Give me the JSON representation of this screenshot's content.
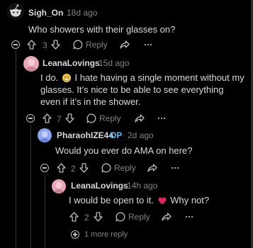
{
  "comments": [
    {
      "username": "Sigh_On",
      "time": "18d ago",
      "body": "Who showers with their glasses on?",
      "votes": "3",
      "reply_label": "Reply"
    },
    {
      "username": "LeanaLovings",
      "time": "15d ago",
      "body_part1": "I do.",
      "body_part2": " I hate having a single moment without my glasses. It’s nice to be able to see everything even if it’s in the shower.",
      "emoji": "grimacing-face",
      "votes": "7",
      "reply_label": "Reply"
    },
    {
      "username": "PharaohIZE44",
      "op_badge": "OP",
      "time": "2d ago",
      "body": "Would you ever do AMA on here?",
      "votes": "2",
      "reply_label": "Reply"
    },
    {
      "username": "LeanaLovings",
      "time": "14h ago",
      "body_part1": "I would be open to it.",
      "body_part2": " Why not?",
      "emoji": "red-heart",
      "votes": "2",
      "reply_label": "Reply"
    }
  ],
  "more_replies": "1 more reply",
  "separator": "·",
  "icons": [
    "upvote-icon",
    "downvote-icon",
    "reply-bubble-icon",
    "share-icon",
    "more-icon",
    "collapse-icon",
    "expand-icon"
  ],
  "colors": {
    "background": "#000000",
    "text": "#d7dadc",
    "meta": "#818384",
    "op": "#4fbcff",
    "avatar_pink": "#e8a8b8",
    "avatar_blue": "#8da4f0"
  }
}
